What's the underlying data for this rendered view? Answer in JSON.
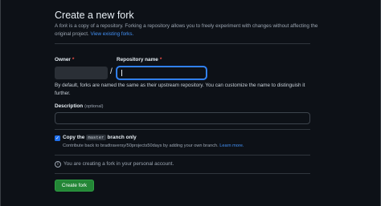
{
  "page": {
    "title": "Create a new fork",
    "description_prefix": "A ",
    "description_italic": "fork",
    "description_rest": " is a copy of a repository. Forking a repository allows you to freely experiment with changes without affecting the original project. ",
    "view_forks_link": "View existing forks."
  },
  "form": {
    "owner_label": "Owner",
    "repo_label": "Repository name",
    "required_mark": "*",
    "separator": "/",
    "repo_value": "",
    "naming_note": "By default, forks are named the same as their upstream repository. You can customize the name to distinguish it further.",
    "description_label": "Description",
    "description_optional": "(optional)",
    "description_value": "",
    "copy_prefix": "Copy the",
    "copy_branch": "master",
    "copy_suffix": "branch only",
    "copy_checked": true,
    "copy_help_text": "Contribute back to bradtraversy/50projects50days by adding your own branch. ",
    "learn_more": "Learn more.",
    "info_text": "You are creating a fork in your personal account.",
    "submit_label": "Create fork"
  },
  "colors": {
    "background": "#0d1117",
    "accent": "#4493f8",
    "primary_button": "#238636",
    "required": "#f85149"
  },
  "icons": {
    "check": "check-icon",
    "info": "info-icon"
  }
}
